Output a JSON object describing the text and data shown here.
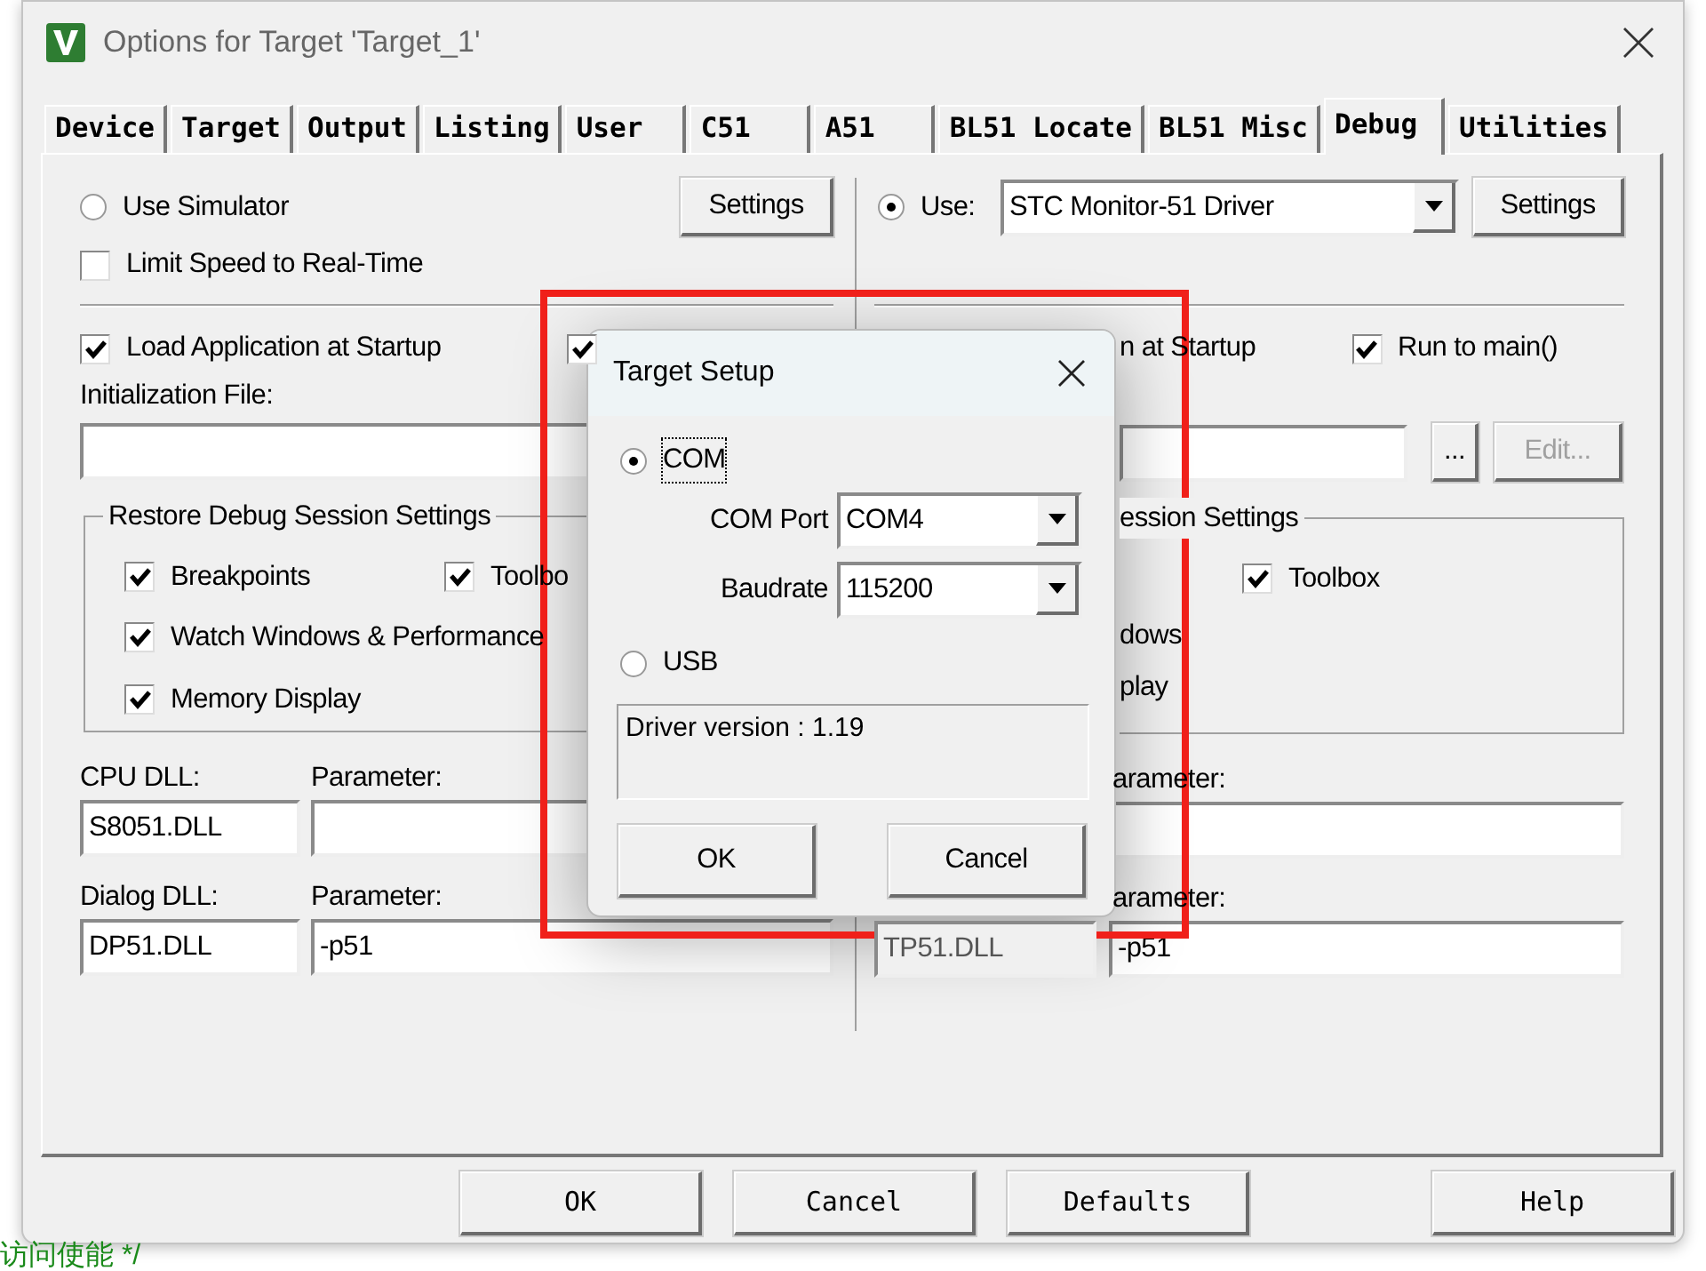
{
  "window": {
    "title": "Options for Target 'Target_1'"
  },
  "tabs": [
    {
      "label": "Device",
      "selected": false
    },
    {
      "label": "Target",
      "selected": false
    },
    {
      "label": "Output",
      "selected": false
    },
    {
      "label": "Listing",
      "selected": false
    },
    {
      "label": "User",
      "selected": false
    },
    {
      "label": "C51",
      "selected": false
    },
    {
      "label": "A51",
      "selected": false
    },
    {
      "label": "BL51 Locate",
      "selected": false
    },
    {
      "label": "BL51 Misc",
      "selected": false
    },
    {
      "label": "Debug",
      "selected": true
    },
    {
      "label": "Utilities",
      "selected": false
    }
  ],
  "left": {
    "simulator": {
      "label": "Use Simulator",
      "selected": false
    },
    "settings_button": "Settings",
    "limit_speed": {
      "label": "Limit Speed to Real-Time",
      "checked": false
    },
    "load_app": {
      "label": "Load Application at Startup",
      "checked": true
    },
    "second_option": {
      "checked": true
    },
    "init_file_label": "Initialization File:",
    "restore": {
      "legend": "Restore Debug Session Settings",
      "options": [
        {
          "label": "Breakpoints",
          "checked": true
        },
        {
          "label": "Toolbo",
          "checked": true
        },
        {
          "label": "Watch Windows & Performance",
          "checked": true
        },
        {
          "label": "Memory Display",
          "checked": true
        }
      ]
    },
    "cpu_dll": {
      "label": "CPU DLL:",
      "value": "S8051.DLL",
      "param_label": "Parameter:"
    },
    "dialog_dll": {
      "label": "Dialog DLL:",
      "value": "DP51.DLL",
      "param_label": "Parameter:",
      "param": "-p51"
    }
  },
  "right": {
    "use": {
      "label": "Use:",
      "selected": true
    },
    "driver": "STC Monitor-51 Driver",
    "settings_button": "Settings",
    "load_app_tail": "n at Startup",
    "run_to_main": {
      "label": "Run to main()",
      "checked": true
    },
    "browse_button": "...",
    "edit_button": {
      "label": "Edit...",
      "disabled": true
    },
    "restore": {
      "legend": "ession Settings",
      "option": {
        "label": "Toolbox",
        "checked": true
      },
      "fragments": [
        "dows",
        "play"
      ]
    },
    "cpu_dll": {
      "param_label": "arameter:"
    },
    "dialog_dll": {
      "value": "TP51.DLL",
      "param_label": "arameter:",
      "param": "-p51"
    }
  },
  "target_setup": {
    "title": "Target Setup",
    "interfaces": [
      {
        "label": "COM",
        "selected": true
      },
      {
        "label": "USB",
        "selected": false
      }
    ],
    "com_port": {
      "label": "COM Port",
      "value": "COM4"
    },
    "baudrate": {
      "label": "Baudrate",
      "value": "115200"
    },
    "info": "Driver version : 1.19",
    "buttons": [
      "OK",
      "Cancel"
    ]
  },
  "footer_buttons": [
    "OK",
    "Cancel",
    "Defaults",
    "Help"
  ],
  "editor_line": "访问使能 */"
}
